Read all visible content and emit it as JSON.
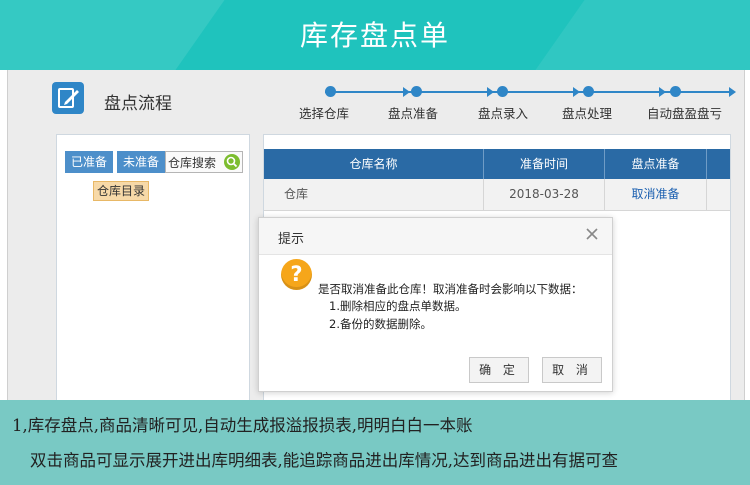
{
  "banner": {
    "title": "库存盘点单"
  },
  "app": {
    "title": "盘点流程"
  },
  "steps": [
    {
      "label": "选择仓库"
    },
    {
      "label": "盘点准备"
    },
    {
      "label": "盘点录入"
    },
    {
      "label": "盘点处理"
    },
    {
      "label": "自动盘盈盘亏"
    }
  ],
  "left_panel": {
    "tabs": [
      "已准备",
      "未准备"
    ],
    "search_placeholder": "仓库搜索",
    "tree_root": "仓库目录"
  },
  "table": {
    "headers": [
      "仓库名称",
      "准备时间",
      "盘点准备"
    ],
    "rows": [
      {
        "name": "仓库",
        "date": "2018-03-28",
        "action": "取消准备"
      }
    ]
  },
  "dialog": {
    "title": "提示",
    "message_lines": [
      "是否取消准备此仓库！取消准备时会影响以下数据：",
      "1.删除相应的盘点单数据。",
      "2.备份的数据删除。"
    ],
    "confirm_label": "确 定",
    "cancel_label": "取 消"
  },
  "caption": {
    "line1": "1,库存盘点,商品清晰可见,自动生成报溢报损表,明明白白一本账",
    "line2": "双击商品可显示展开进出库明细表,能追踪商品进出库情况,达到商品进出有据可查"
  },
  "colors": {
    "banner": "#1fc3bd",
    "accent_blue": "#2f86c7",
    "table_header": "#2a6aa5",
    "warning": "#f6a61a",
    "caption_bg": "#79c9c4"
  },
  "icons": {
    "app": "edit-document-icon",
    "search": "search-icon",
    "close": "close-icon",
    "warning": "question-mark-icon"
  }
}
